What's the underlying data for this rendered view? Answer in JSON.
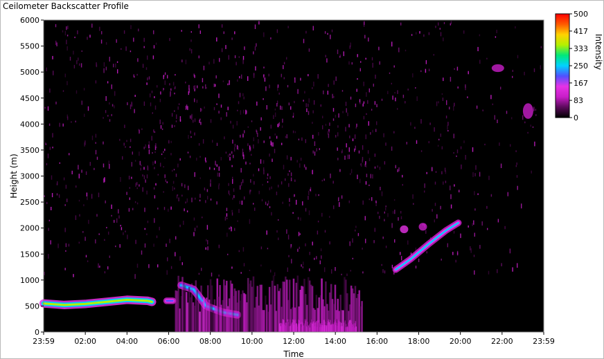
{
  "window": {
    "title": "Ceilometer Backscatter Profile"
  },
  "colors": {
    "background": "#000000",
    "scale": [
      "#000000",
      "#5a0a5a",
      "#c81ec8",
      "#e632e6",
      "#5050ff",
      "#00d2ff",
      "#00e87a",
      "#b4f000",
      "#ffd200",
      "#ff5a00",
      "#ff0000"
    ]
  },
  "chart_data": {
    "type": "heatmap",
    "title": "",
    "xlabel": "Time",
    "ylabel": "Height (m)",
    "colorbar_label": "Intensity",
    "x_ticks": [
      "23:59",
      "02:00",
      "04:00",
      "06:00",
      "08:00",
      "10:00",
      "12:00",
      "14:00",
      "16:00",
      "18:00",
      "20:00",
      "22:00",
      "23:59"
    ],
    "x_tick_hours": [
      0,
      2,
      4,
      6,
      8,
      10,
      12,
      14,
      16,
      18,
      20,
      22,
      24
    ],
    "x_range_hours": [
      0,
      24
    ],
    "ylim": [
      0,
      6000
    ],
    "y_ticks": [
      "0",
      "500",
      "1000",
      "1500",
      "2000",
      "2500",
      "3000",
      "3500",
      "4000",
      "4500",
      "5000",
      "5500",
      "6000"
    ],
    "y_tick_values": [
      0,
      500,
      1000,
      1500,
      2000,
      2500,
      3000,
      3500,
      4000,
      4500,
      5000,
      5500,
      6000
    ],
    "colorbar_ticks": [
      "500",
      "417",
      "333",
      "250",
      "167",
      "83",
      "0"
    ],
    "colorbar_tick_values": [
      500,
      417,
      333,
      250,
      167,
      83,
      0
    ],
    "colorbar_range": [
      0,
      500
    ],
    "features": [
      {
        "kind": "layer",
        "points": [
          [
            0.0,
            550
          ],
          [
            1.0,
            520
          ],
          [
            2.0,
            540
          ],
          [
            3.0,
            580
          ],
          [
            4.0,
            620
          ],
          [
            5.0,
            600
          ],
          [
            5.2,
            580
          ]
        ],
        "thickness": 90,
        "intensity": 350
      },
      {
        "kind": "layer",
        "points": [
          [
            5.9,
            600
          ],
          [
            6.2,
            600
          ]
        ],
        "thickness": 70,
        "intensity": 200
      },
      {
        "kind": "layer",
        "points": [
          [
            6.6,
            900
          ],
          [
            7.2,
            820
          ],
          [
            7.8,
            500
          ],
          [
            8.6,
            380
          ],
          [
            9.3,
            330
          ]
        ],
        "thickness": 80,
        "intensity": 240
      },
      {
        "kind": "layer",
        "points": [
          [
            16.9,
            1200
          ],
          [
            17.6,
            1400
          ],
          [
            18.5,
            1700
          ],
          [
            19.3,
            1950
          ],
          [
            19.9,
            2100
          ]
        ],
        "thickness": 70,
        "intensity": 230
      },
      {
        "kind": "region",
        "hours": [
          6.3,
          15.3
        ],
        "heights": [
          0,
          1100
        ],
        "intensity": 120
      },
      {
        "kind": "region",
        "hours": [
          11.3,
          15.0
        ],
        "heights": [
          0,
          250
        ],
        "intensity": 140
      },
      {
        "kind": "patch",
        "hours": [
          21.5,
          22.1
        ],
        "heights": [
          5000,
          5150
        ],
        "intensity": 110
      },
      {
        "kind": "patch",
        "hours": [
          23.0,
          23.5
        ],
        "heights": [
          4100,
          4400
        ],
        "intensity": 100
      },
      {
        "kind": "patch",
        "hours": [
          17.1,
          17.5
        ],
        "heights": [
          1900,
          2050
        ],
        "intensity": 130
      },
      {
        "kind": "patch",
        "hours": [
          18.0,
          18.4
        ],
        "heights": [
          1950,
          2100
        ],
        "intensity": 120
      }
    ]
  }
}
